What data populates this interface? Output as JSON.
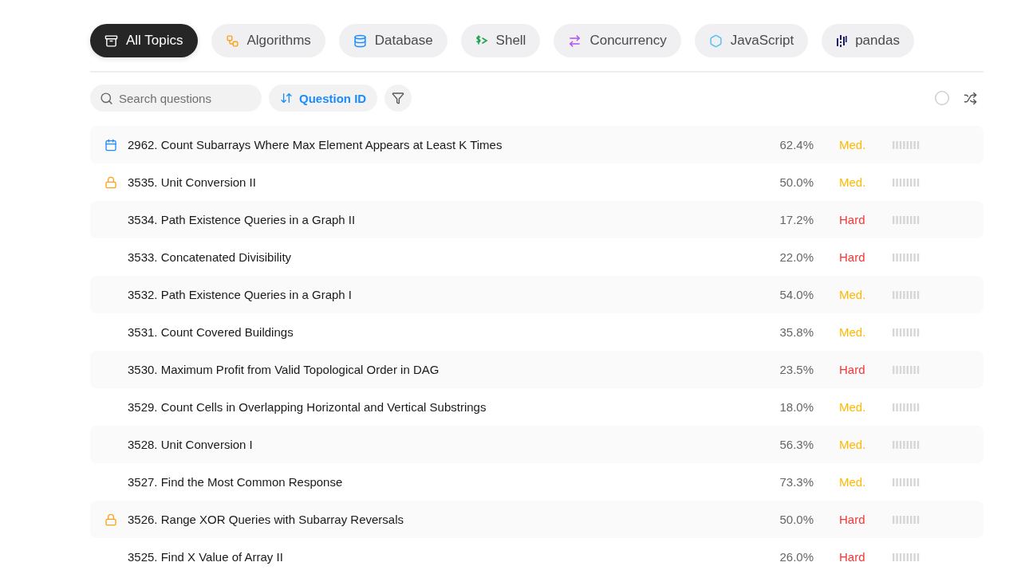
{
  "topics": [
    {
      "label": "All Topics",
      "kind": "archive",
      "selected": true
    },
    {
      "label": "Algorithms",
      "kind": "workflow",
      "selected": false
    },
    {
      "label": "Database",
      "kind": "database",
      "selected": false
    },
    {
      "label": "Shell",
      "kind": "shell",
      "selected": false
    },
    {
      "label": "Concurrency",
      "kind": "concurrency",
      "selected": false
    },
    {
      "label": "JavaScript",
      "kind": "javascript",
      "selected": false
    },
    {
      "label": "pandas",
      "kind": "pandas",
      "selected": false
    }
  ],
  "search": {
    "placeholder": "Search questions"
  },
  "sort": {
    "label": "Question ID"
  },
  "questions": [
    {
      "title": "2962. Count Subarrays Where Max Element Appears at Least K Times",
      "acceptance": "62.4%",
      "difficulty": "Med.",
      "color": "#ffb800",
      "kind": "daily"
    },
    {
      "title": "3535. Unit Conversion II",
      "acceptance": "50.0%",
      "difficulty": "Med.",
      "color": "#ffb800",
      "kind": "locked"
    },
    {
      "title": "3534. Path Existence Queries in a Graph II",
      "acceptance": "17.2%",
      "difficulty": "Hard",
      "color": "#f63636",
      "kind": "plain"
    },
    {
      "title": "3533. Concatenated Divisibility",
      "acceptance": "22.0%",
      "difficulty": "Hard",
      "color": "#f63636",
      "kind": "plain"
    },
    {
      "title": "3532. Path Existence Queries in a Graph I",
      "acceptance": "54.0%",
      "difficulty": "Med.",
      "color": "#ffb800",
      "kind": "plain"
    },
    {
      "title": "3531. Count Covered Buildings",
      "acceptance": "35.8%",
      "difficulty": "Med.",
      "color": "#ffb800",
      "kind": "plain"
    },
    {
      "title": "3530. Maximum Profit from Valid Topological Order in DAG",
      "acceptance": "23.5%",
      "difficulty": "Hard",
      "color": "#f63636",
      "kind": "plain"
    },
    {
      "title": "3529. Count Cells in Overlapping Horizontal and Vertical Substrings",
      "acceptance": "18.0%",
      "difficulty": "Med.",
      "color": "#ffb800",
      "kind": "plain"
    },
    {
      "title": "3528. Unit Conversion I",
      "acceptance": "56.3%",
      "difficulty": "Med.",
      "color": "#ffb800",
      "kind": "plain"
    },
    {
      "title": "3527. Find the Most Common Response",
      "acceptance": "73.3%",
      "difficulty": "Med.",
      "color": "#ffb800",
      "kind": "plain"
    },
    {
      "title": "3526. Range XOR Queries with Subarray Reversals",
      "acceptance": "50.0%",
      "difficulty": "Hard",
      "color": "#f63636",
      "kind": "locked"
    },
    {
      "title": "3525. Find X Value of Array II",
      "acceptance": "26.0%",
      "difficulty": "Hard",
      "color": "#f63636",
      "kind": "plain"
    }
  ]
}
